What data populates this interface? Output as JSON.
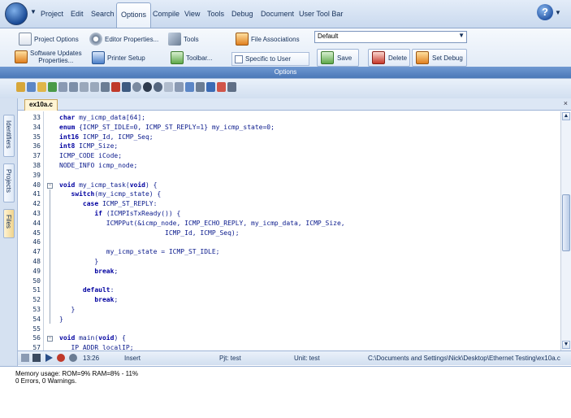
{
  "menubar": {
    "items": [
      "Project",
      "Edit",
      "Search",
      "Options",
      "Compile",
      "View",
      "Tools",
      "Debug",
      "Document",
      "User Tool Bar"
    ],
    "active": "Options"
  },
  "ribbon": {
    "project_options": "Project Options",
    "editor_properties": "Editor Properties...",
    "tools": "Tools",
    "file_associations": "File Associations",
    "config_value": "Default",
    "software_updates_line1": "Software Updates",
    "software_updates_line2": "Properties...",
    "printer_setup": "Printer Setup",
    "toolbar": "Toolbar...",
    "specific_to_user": "Specific to User",
    "save": "Save",
    "delete": "Delete",
    "set_debug": "Set Debug",
    "group_label": "Options"
  },
  "side_tabs": [
    "Identifiers",
    "Projects",
    "Files"
  ],
  "editor": {
    "tab": "ex10a.c",
    "lines": [
      {
        "n": "33",
        "code": "char my_icmp_data[64];"
      },
      {
        "n": "34",
        "code": "enum {ICMP_ST_IDLE=0, ICMP_ST_REPLY=1} my_icmp_state=0;"
      },
      {
        "n": "35",
        "code": "int16 ICMP_Id, ICMP_Seq;"
      },
      {
        "n": "36",
        "code": "int8 ICMP_Size;"
      },
      {
        "n": "37",
        "code": "ICMP_CODE iCode;"
      },
      {
        "n": "38",
        "code": "NODE_INFO icmp_node;"
      },
      {
        "n": "39",
        "code": ""
      },
      {
        "n": "40",
        "code": "void my_icmp_task(void) {"
      },
      {
        "n": "41",
        "code": "   switch(my_icmp_state) {"
      },
      {
        "n": "42",
        "code": "      case ICMP_ST_REPLY:"
      },
      {
        "n": "43",
        "code": "         if (ICMPIsTxReady()) {"
      },
      {
        "n": "44",
        "code": "            ICMPPut(&icmp_node, ICMP_ECHO_REPLY, my_icmp_data, ICMP_Size,"
      },
      {
        "n": "45",
        "code": "                           ICMP_Id, ICMP_Seq);"
      },
      {
        "n": "46",
        "code": ""
      },
      {
        "n": "47",
        "code": "            my_icmp_state = ICMP_ST_IDLE;"
      },
      {
        "n": "48",
        "code": "         }"
      },
      {
        "n": "49",
        "code": "         break;"
      },
      {
        "n": "50",
        "code": ""
      },
      {
        "n": "51",
        "code": "      default:"
      },
      {
        "n": "52",
        "code": "         break;"
      },
      {
        "n": "53",
        "code": "   }"
      },
      {
        "n": "54",
        "code": "}"
      },
      {
        "n": "55",
        "code": ""
      },
      {
        "n": "56",
        "code": "void main(void) {"
      },
      {
        "n": "57",
        "code": "   IP_ADDR localIP;"
      }
    ]
  },
  "status": {
    "time": "13:26",
    "mode": "Insert",
    "project": "Pjt: test",
    "unit": "Unit: test",
    "path": "C:\\Documents and Settings\\Nick\\Desktop\\Ethernet Testing\\ex10a.c"
  },
  "output": {
    "line1": "Memory usage:   ROM=9%      RAM=8% - 11%",
    "line2": "0 Errors,  0 Warnings."
  }
}
